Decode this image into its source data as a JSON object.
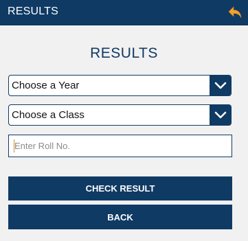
{
  "topbar": {
    "title": "RESULTS",
    "back_icon": "undo-arrow-icon",
    "background": "#0f3a64",
    "icon_color": "#f0a327"
  },
  "main": {
    "heading": "RESULTS",
    "year_select": {
      "value": "Choose a Year"
    },
    "class_select": {
      "value": "Choose a Class"
    },
    "roll_input": {
      "value": "",
      "placeholder": "Enter Roll No."
    },
    "check_button_label": "CHECK RESULT",
    "back_button_label": "BACK"
  },
  "colors": {
    "accent": "#0f3a64",
    "background": "#f1f1f1",
    "caret": "#d98a2b"
  }
}
